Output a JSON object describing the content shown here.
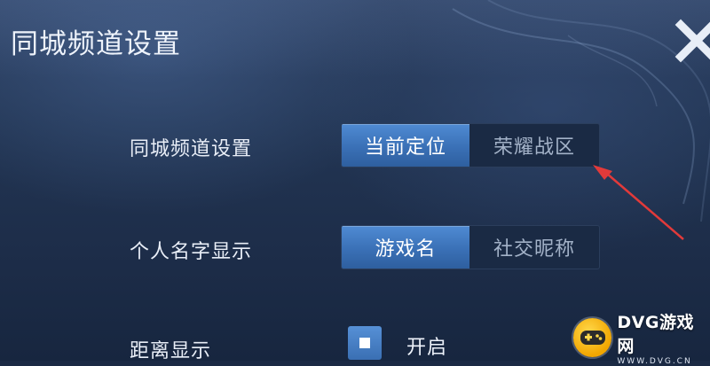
{
  "header": {
    "title": "同城频道设置",
    "close_icon": "close-icon"
  },
  "settings": {
    "rows": [
      {
        "label": "同城频道设置",
        "options": [
          "当前定位",
          "荣耀战区"
        ],
        "selected": "当前定位"
      },
      {
        "label": "个人名字显示",
        "options": [
          "游戏名",
          "社交昵称"
        ],
        "selected": "游戏名"
      }
    ],
    "distance": {
      "label": "距离显示",
      "toggle_label": "开启",
      "checked": true
    }
  },
  "annotation": {
    "color": "#e23a3a",
    "icon": "red-arrow-icon"
  },
  "watermark": {
    "brand": "DVG游戏网",
    "url": "WWW.DVG.CN",
    "icon": "gamepad-icon"
  },
  "colors": {
    "accent": "#3f78c0",
    "background": "#1d2d49",
    "text": "#e9eef7",
    "inactive_text": "#a3b2c8"
  }
}
